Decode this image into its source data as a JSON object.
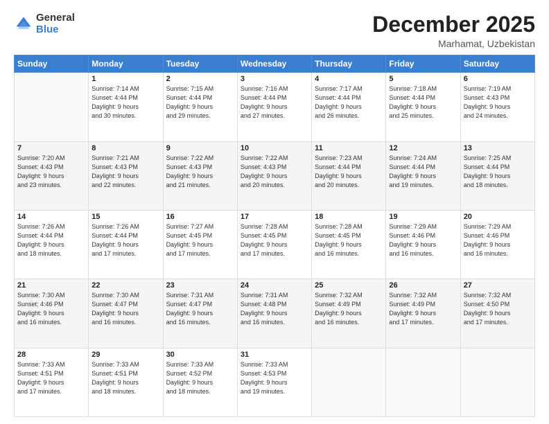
{
  "logo": {
    "general": "General",
    "blue": "Blue"
  },
  "header": {
    "month": "December 2025",
    "location": "Marhamat, Uzbekistan"
  },
  "weekdays": [
    "Sunday",
    "Monday",
    "Tuesday",
    "Wednesday",
    "Thursday",
    "Friday",
    "Saturday"
  ],
  "weeks": [
    [
      {
        "num": "",
        "info": ""
      },
      {
        "num": "1",
        "info": "Sunrise: 7:14 AM\nSunset: 4:44 PM\nDaylight: 9 hours\nand 30 minutes."
      },
      {
        "num": "2",
        "info": "Sunrise: 7:15 AM\nSunset: 4:44 PM\nDaylight: 9 hours\nand 29 minutes."
      },
      {
        "num": "3",
        "info": "Sunrise: 7:16 AM\nSunset: 4:44 PM\nDaylight: 9 hours\nand 27 minutes."
      },
      {
        "num": "4",
        "info": "Sunrise: 7:17 AM\nSunset: 4:44 PM\nDaylight: 9 hours\nand 26 minutes."
      },
      {
        "num": "5",
        "info": "Sunrise: 7:18 AM\nSunset: 4:44 PM\nDaylight: 9 hours\nand 25 minutes."
      },
      {
        "num": "6",
        "info": "Sunrise: 7:19 AM\nSunset: 4:43 PM\nDaylight: 9 hours\nand 24 minutes."
      }
    ],
    [
      {
        "num": "7",
        "info": "Sunrise: 7:20 AM\nSunset: 4:43 PM\nDaylight: 9 hours\nand 23 minutes."
      },
      {
        "num": "8",
        "info": "Sunrise: 7:21 AM\nSunset: 4:43 PM\nDaylight: 9 hours\nand 22 minutes."
      },
      {
        "num": "9",
        "info": "Sunrise: 7:22 AM\nSunset: 4:43 PM\nDaylight: 9 hours\nand 21 minutes."
      },
      {
        "num": "10",
        "info": "Sunrise: 7:22 AM\nSunset: 4:43 PM\nDaylight: 9 hours\nand 20 minutes."
      },
      {
        "num": "11",
        "info": "Sunrise: 7:23 AM\nSunset: 4:44 PM\nDaylight: 9 hours\nand 20 minutes."
      },
      {
        "num": "12",
        "info": "Sunrise: 7:24 AM\nSunset: 4:44 PM\nDaylight: 9 hours\nand 19 minutes."
      },
      {
        "num": "13",
        "info": "Sunrise: 7:25 AM\nSunset: 4:44 PM\nDaylight: 9 hours\nand 18 minutes."
      }
    ],
    [
      {
        "num": "14",
        "info": "Sunrise: 7:26 AM\nSunset: 4:44 PM\nDaylight: 9 hours\nand 18 minutes."
      },
      {
        "num": "15",
        "info": "Sunrise: 7:26 AM\nSunset: 4:44 PM\nDaylight: 9 hours\nand 17 minutes."
      },
      {
        "num": "16",
        "info": "Sunrise: 7:27 AM\nSunset: 4:45 PM\nDaylight: 9 hours\nand 17 minutes."
      },
      {
        "num": "17",
        "info": "Sunrise: 7:28 AM\nSunset: 4:45 PM\nDaylight: 9 hours\nand 17 minutes."
      },
      {
        "num": "18",
        "info": "Sunrise: 7:28 AM\nSunset: 4:45 PM\nDaylight: 9 hours\nand 16 minutes."
      },
      {
        "num": "19",
        "info": "Sunrise: 7:29 AM\nSunset: 4:46 PM\nDaylight: 9 hours\nand 16 minutes."
      },
      {
        "num": "20",
        "info": "Sunrise: 7:29 AM\nSunset: 4:46 PM\nDaylight: 9 hours\nand 16 minutes."
      }
    ],
    [
      {
        "num": "21",
        "info": "Sunrise: 7:30 AM\nSunset: 4:46 PM\nDaylight: 9 hours\nand 16 minutes."
      },
      {
        "num": "22",
        "info": "Sunrise: 7:30 AM\nSunset: 4:47 PM\nDaylight: 9 hours\nand 16 minutes."
      },
      {
        "num": "23",
        "info": "Sunrise: 7:31 AM\nSunset: 4:47 PM\nDaylight: 9 hours\nand 16 minutes."
      },
      {
        "num": "24",
        "info": "Sunrise: 7:31 AM\nSunset: 4:48 PM\nDaylight: 9 hours\nand 16 minutes."
      },
      {
        "num": "25",
        "info": "Sunrise: 7:32 AM\nSunset: 4:49 PM\nDaylight: 9 hours\nand 16 minutes."
      },
      {
        "num": "26",
        "info": "Sunrise: 7:32 AM\nSunset: 4:49 PM\nDaylight: 9 hours\nand 17 minutes."
      },
      {
        "num": "27",
        "info": "Sunrise: 7:32 AM\nSunset: 4:50 PM\nDaylight: 9 hours\nand 17 minutes."
      }
    ],
    [
      {
        "num": "28",
        "info": "Sunrise: 7:33 AM\nSunset: 4:51 PM\nDaylight: 9 hours\nand 17 minutes."
      },
      {
        "num": "29",
        "info": "Sunrise: 7:33 AM\nSunset: 4:51 PM\nDaylight: 9 hours\nand 18 minutes."
      },
      {
        "num": "30",
        "info": "Sunrise: 7:33 AM\nSunset: 4:52 PM\nDaylight: 9 hours\nand 18 minutes."
      },
      {
        "num": "31",
        "info": "Sunrise: 7:33 AM\nSunset: 4:53 PM\nDaylight: 9 hours\nand 19 minutes."
      },
      {
        "num": "",
        "info": ""
      },
      {
        "num": "",
        "info": ""
      },
      {
        "num": "",
        "info": ""
      }
    ]
  ]
}
